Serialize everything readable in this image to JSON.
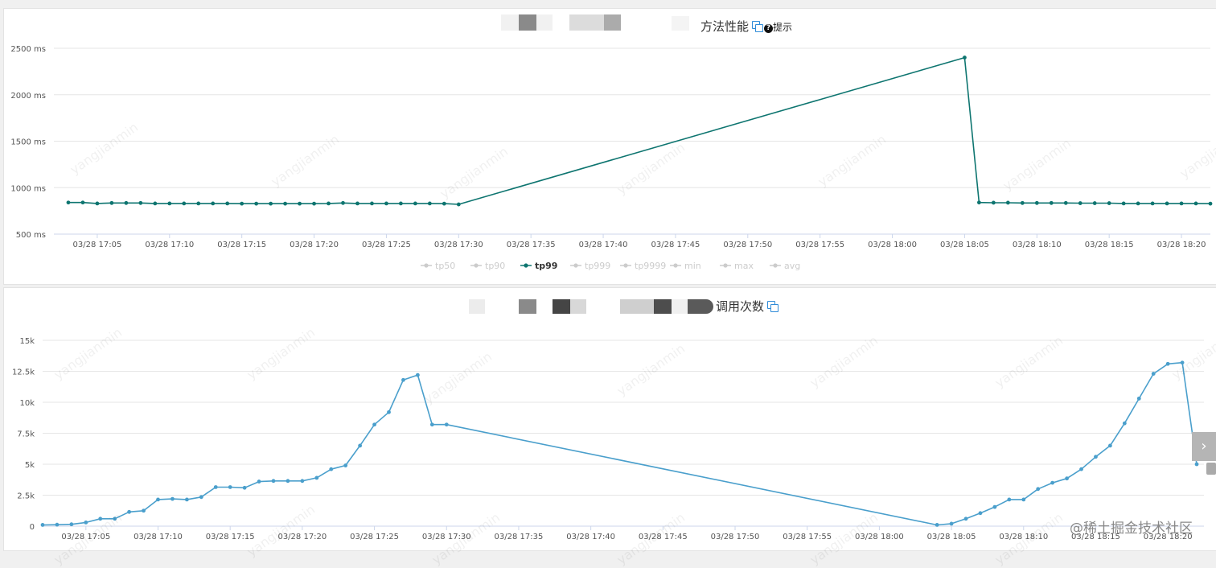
{
  "charts": {
    "perf": {
      "title": "方法性能",
      "hint": "提示",
      "help_glyph": "?",
      "line_color": "#0e7570"
    },
    "calls": {
      "title": "调用次数",
      "line_color": "#4a9fcc"
    }
  },
  "overlay": {
    "watermark_user": "yangjianmin",
    "corner_watermark": "@稀土掘金技术社区",
    "scroll_glyph": "›"
  },
  "chart_data": [
    {
      "type": "line",
      "title": "方法性能",
      "x_ticks": [
        "03/28 17:05",
        "03/28 17:10",
        "03/28 17:15",
        "03/28 17:20",
        "03/28 17:25",
        "03/28 17:30",
        "03/28 17:35",
        "03/28 17:40",
        "03/28 17:45",
        "03/28 17:50",
        "03/28 17:55",
        "03/28 18:00",
        "03/28 18:05",
        "03/28 18:10",
        "03/28 18:15",
        "03/28 18:20"
      ],
      "y_ticks": [
        "500 ms",
        "1000 ms",
        "1500 ms",
        "2000 ms",
        "2500 ms"
      ],
      "ylim": [
        500,
        2500
      ],
      "xlim": [
        2,
        82
      ],
      "grid": true,
      "legend_position": "bottom",
      "legend": [
        {
          "name": "tp50",
          "active": false
        },
        {
          "name": "tp90",
          "active": false
        },
        {
          "name": "tp99",
          "active": true
        },
        {
          "name": "tp999",
          "active": false
        },
        {
          "name": "tp9999",
          "active": false
        },
        {
          "name": "min",
          "active": false
        },
        {
          "name": "max",
          "active": false
        },
        {
          "name": "avg",
          "active": false
        }
      ],
      "series": [
        {
          "name": "tp99",
          "x": [
            3,
            4,
            5,
            6,
            7,
            8,
            9,
            10,
            11,
            12,
            13,
            14,
            15,
            16,
            17,
            18,
            19,
            20,
            21,
            22,
            23,
            24,
            25,
            26,
            27,
            28,
            29,
            30,
            65,
            66,
            67,
            68,
            69,
            70,
            71,
            72,
            73,
            74,
            75,
            76,
            77,
            78,
            79,
            80,
            81,
            82
          ],
          "values": [
            840,
            840,
            830,
            835,
            835,
            835,
            830,
            830,
            830,
            830,
            830,
            830,
            828,
            828,
            828,
            828,
            828,
            828,
            830,
            835,
            830,
            830,
            830,
            830,
            830,
            830,
            828,
            820,
            2400,
            840,
            838,
            838,
            835,
            835,
            835,
            835,
            833,
            833,
            833,
            830,
            830,
            830,
            830,
            830,
            830,
            828
          ]
        }
      ]
    },
    {
      "type": "line",
      "title": "调用次数",
      "x_ticks": [
        "03/28 17:05",
        "03/28 17:10",
        "03/28 17:15",
        "03/28 17:20",
        "03/28 17:25",
        "03/28 17:30",
        "03/28 17:35",
        "03/28 17:40",
        "03/28 17:45",
        "03/28 17:50",
        "03/28 17:55",
        "03/28 18:00",
        "03/28 18:05",
        "03/28 18:10",
        "03/28 18:15",
        "03/28 18:20"
      ],
      "y_ticks": [
        "0",
        "2.5k",
        "5k",
        "7.5k",
        "10k",
        "12.5k",
        "15k"
      ],
      "ylim": [
        0,
        15000
      ],
      "xlim": [
        2,
        82.5
      ],
      "grid": true,
      "series": [
        {
          "name": "调用次数",
          "x": [
            2,
            3,
            4,
            5,
            6,
            7,
            8,
            9,
            10,
            11,
            12,
            13,
            14,
            15,
            16,
            17,
            18,
            19,
            20,
            21,
            22,
            23,
            24,
            25,
            26,
            27,
            28,
            29,
            30,
            64,
            65,
            66,
            67,
            68,
            69,
            70,
            71,
            72,
            73,
            74,
            75,
            76,
            77,
            78,
            79,
            80,
            81,
            82
          ],
          "values": [
            100,
            120,
            150,
            300,
            600,
            600,
            1150,
            1250,
            2150,
            2200,
            2150,
            2350,
            3150,
            3150,
            3100,
            3600,
            3650,
            3650,
            3650,
            3900,
            4600,
            4900,
            6500,
            8200,
            9200,
            11800,
            12200,
            8200,
            8200,
            100,
            200,
            600,
            1050,
            1550,
            2150,
            2150,
            3000,
            3500,
            3850,
            4600,
            5600,
            6500,
            8300,
            10300,
            12300,
            13100,
            13200,
            5000
          ]
        }
      ]
    }
  ]
}
